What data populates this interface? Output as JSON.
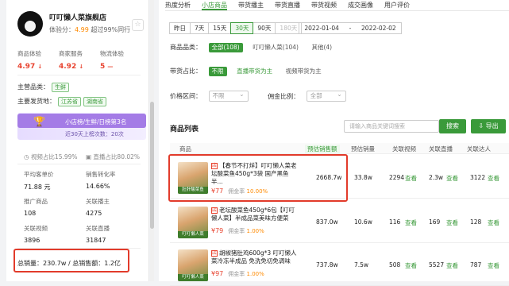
{
  "shop": {
    "name": "叮叮懒人菜旗舰店",
    "score_label": "体验分：",
    "score": "4.99",
    "score_suffix": "超过99%同行"
  },
  "metrics": [
    {
      "label": "商品体验",
      "value": "4.97"
    },
    {
      "label": "商家服务",
      "value": "4.92"
    },
    {
      "label": "物流体验",
      "value": "5"
    }
  ],
  "main_category": {
    "label": "主营品类：",
    "tag": "生鲜"
  },
  "ship_from": {
    "label": "主要发货地：",
    "tags": [
      "江苏省",
      "湖南省"
    ]
  },
  "rank": {
    "text": "小店榜/生鲜/日榜第3名",
    "sub": "近30天上榜次数：20次"
  },
  "ratio": {
    "video": "视频占比15.99%",
    "live": "直播占比80.02%"
  },
  "stats": [
    {
      "label": "平均客单价",
      "value": "71.88 元"
    },
    {
      "label": "销售转化率",
      "value": "14.66%"
    },
    {
      "label": "推广商品",
      "value": "108"
    },
    {
      "label": "关联播主",
      "value": "4275"
    },
    {
      "label": "关联视频",
      "value": "3896"
    },
    {
      "label": "关联直播",
      "value": "31847"
    }
  ],
  "totals": {
    "text": "总销量：230.7w / 总销售额：1.2亿"
  },
  "tabs": [
    "热度分析",
    "小店商品",
    "带货播主",
    "带货直播",
    "带货视频",
    "成交画像",
    "用户评价"
  ],
  "active_tab": 1,
  "date_buttons": [
    "昨日",
    "7天",
    "15天",
    "30天",
    "90天",
    "180天"
  ],
  "date_range": {
    "start": "2022-01-04",
    "sep": "-",
    "end": "2022-02-02"
  },
  "filters": {
    "category_label": "商品品类：",
    "category_options": [
      "全部(108)",
      "叮叮懒人菜(104)",
      "其他(4)"
    ],
    "share_label": "带货占比：",
    "share_options": [
      "不限",
      "直播带货为主",
      "视频带货为主"
    ],
    "price_label": "价格区间：",
    "price_placeholder": "不限",
    "commission_label": "佣金比例：",
    "commission_placeholder": "全部"
  },
  "list": {
    "title": "商品列表",
    "search_placeholder": "请输入商品关键词搜索",
    "search_button": "搜索",
    "export_button": "导出",
    "columns": [
      "商品",
      "预估销售额",
      "预估销量",
      "关联视频",
      "关联直播",
      "关联达人"
    ]
  },
  "products": [
    {
      "name": "【春节不打烊】叮叮懒人菜老坛酸菜鱼450g*3袋 国产黑鱼半...",
      "price": "¥77",
      "commission_label": "佣金率",
      "commission": "10.00%",
      "sales_amount": "2668.7w",
      "sales_volume": "33.8w",
      "videos": "2294",
      "videos_link": "查看",
      "lives": "2.3w",
      "lives_link": "查看",
      "creators": "3122",
      "creators_link": "查看",
      "thumb_label": "肚肝酸菜鱼"
    },
    {
      "name": "老坛酸菜鱼450g*6包【叮叮懒人菜】半成品菜美味方便菜",
      "price": "¥79",
      "commission_label": "佣金率",
      "commission": "1.00%",
      "sales_amount": "837.0w",
      "sales_volume": "10.6w",
      "videos": "116",
      "videos_link": "查看",
      "lives": "169",
      "lives_link": "查看",
      "creators": "128",
      "creators_link": "查看",
      "thumb_label": "叮叮懒人菜"
    },
    {
      "name": "胡椒猪肚鸡600g*3 叮叮懒人菜冷冻半成品 免洗免切免调味",
      "price": "¥97",
      "commission_label": "佣金率",
      "commission": "1.00%",
      "sales_amount": "737.8w",
      "sales_volume": "7.5w",
      "videos": "508",
      "videos_link": "查看",
      "lives": "5527",
      "lives_link": "查看",
      "creators": "787",
      "creators_link": "查看",
      "thumb_label": "叮叮懒人菜"
    }
  ]
}
